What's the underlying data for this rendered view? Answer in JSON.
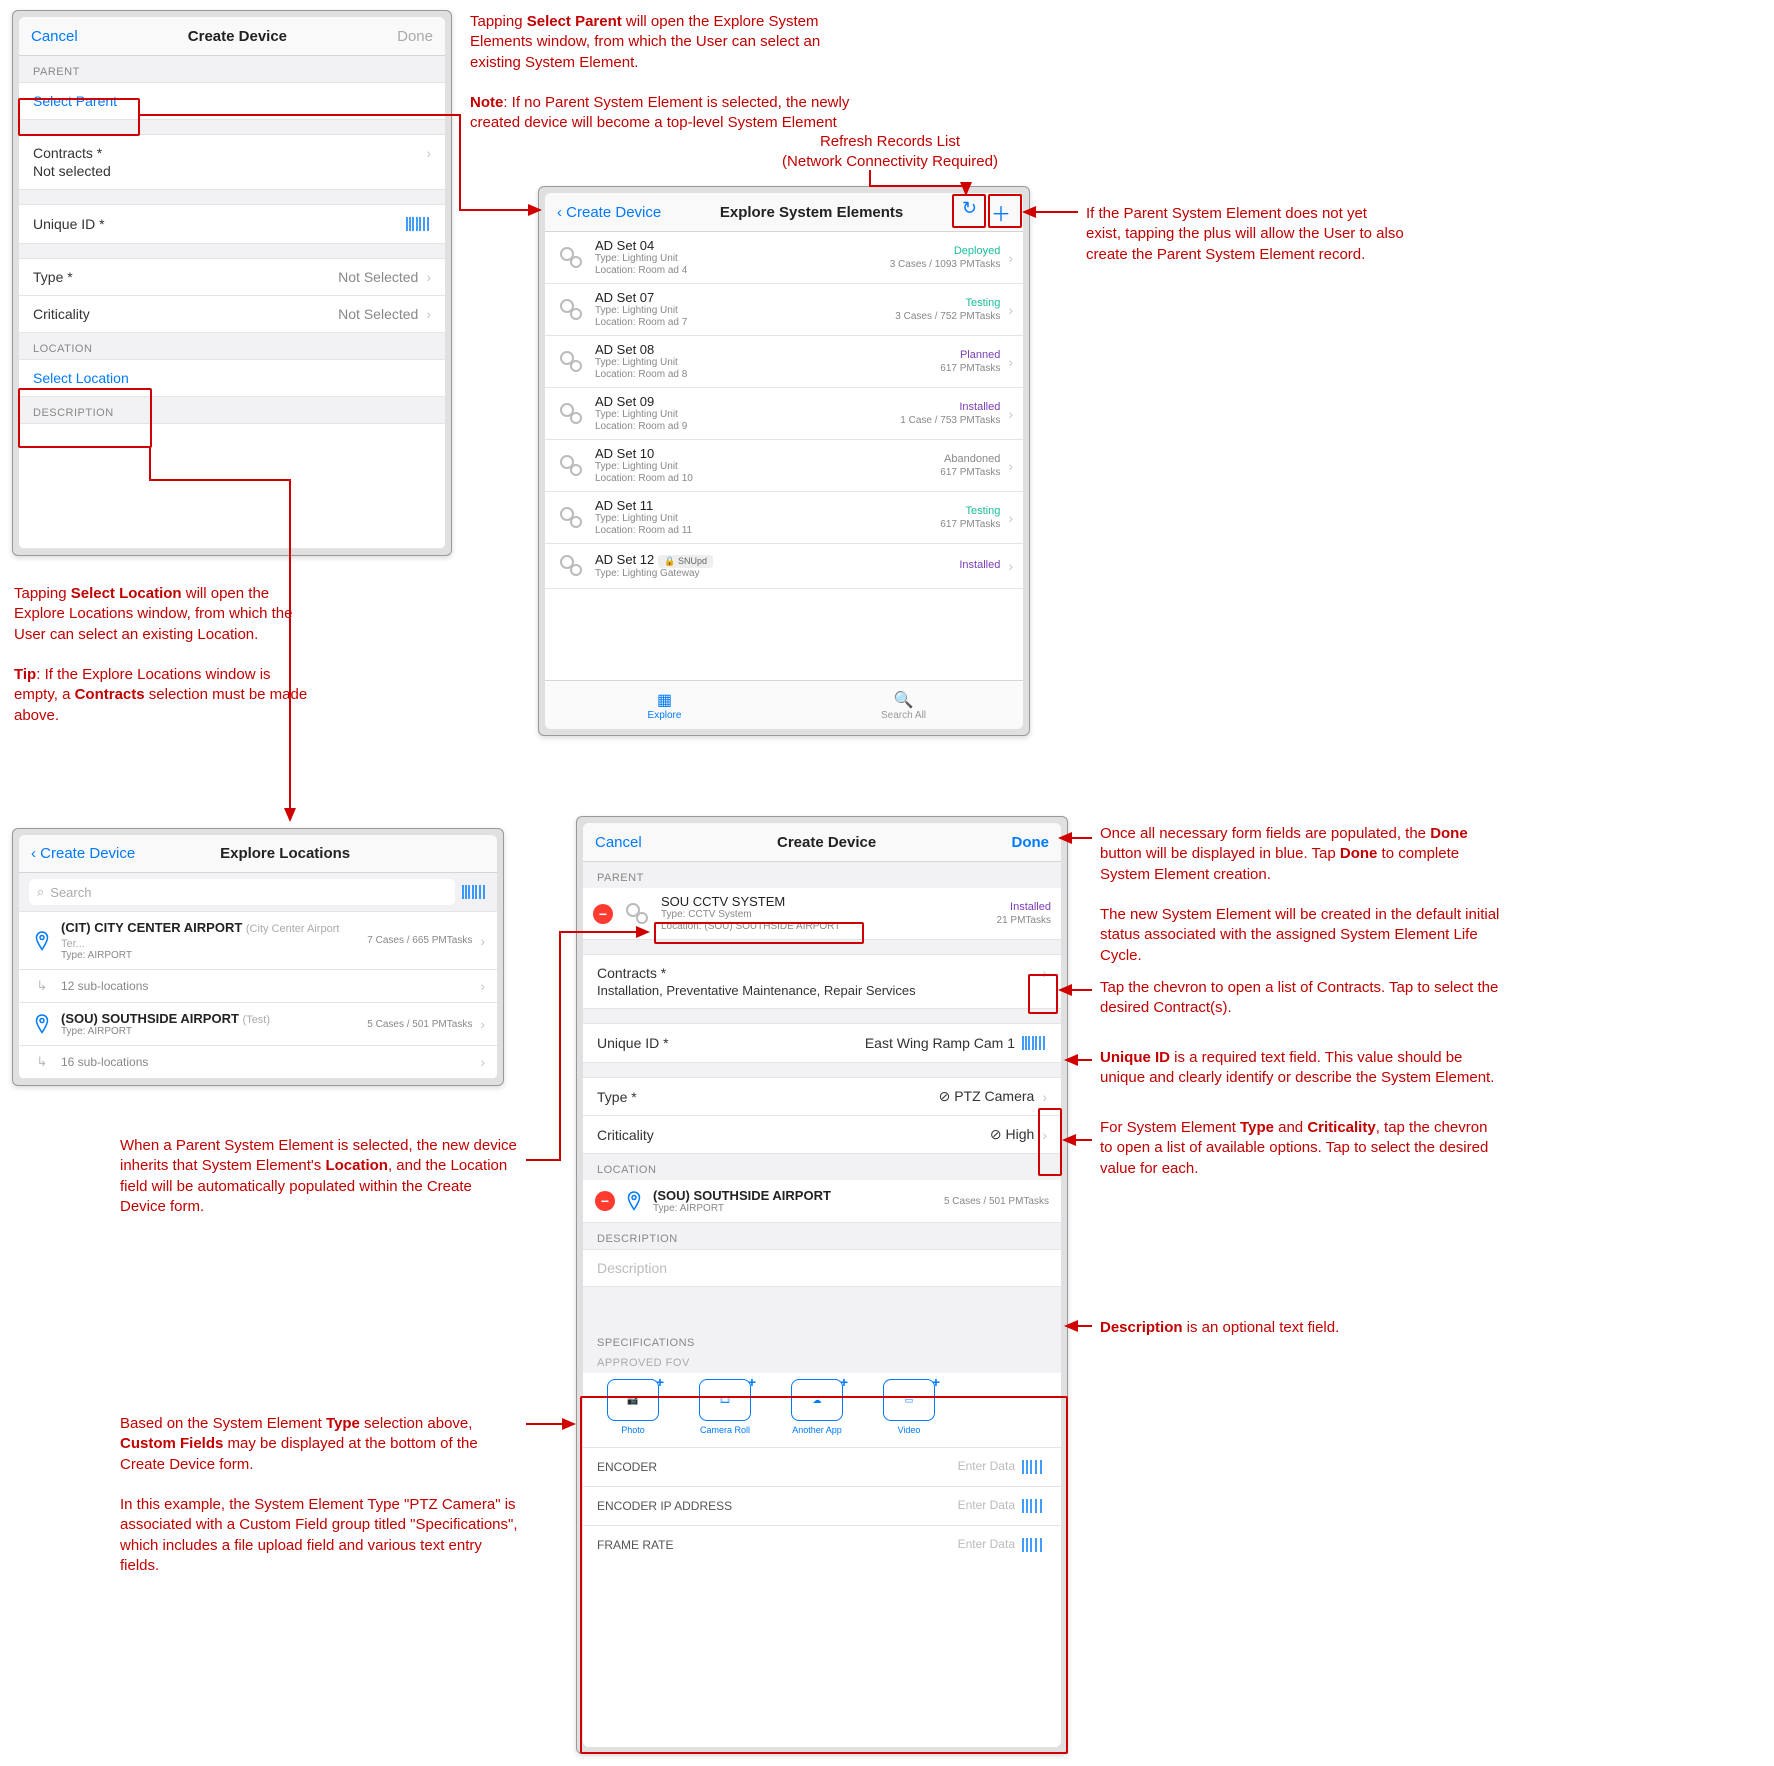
{
  "annotations": {
    "a1": "Tapping <b>Select Parent</b> will open the Explore System Elements window, from which the User can select an existing System Element.",
    "a1note": "<b>Note</b>: If no Parent System Element is selected, the newly created device will become a top-level System Element",
    "a2title": "Refresh Records List",
    "a2sub": "(Network Connectivity Required)",
    "a3": "If the Parent System Element does not yet exist, tapping the plus will allow the User to also create the Parent System Element record.",
    "a4": "Tapping <b>Select Location</b> will open the Explore Locations window, from which the User can select an existing Location.",
    "a4tip": "<b>Tip</b>: If the Explore Locations window is empty, a <b>Contracts</b> selection must be made above.",
    "a5": "When a Parent System Element is selected, the new device inherits that System Element's <b>Location</b>, and the Location field will be automatically populated within the Create Device form.",
    "a6": "Once all necessary form fields are populated, the <b>Done</b> button will be displayed in blue. Tap <b>Done</b> to complete System Element creation.",
    "a6b": "The new System Element will be created in the default initial status associated with the assigned System Element Life Cycle.",
    "a7": "Tap the chevron to open a list of Contracts. Tap to select the desired Contract(s).",
    "a8": "<b>Unique ID</b> is a required text field. This value should be unique and clearly identify or describe the System Element.",
    "a9": "For System Element <b>Type</b> and <b>Criticality</b>, tap the chevron to open a list of available options. Tap to select the desired value for each.",
    "a10": "<b>Description</b> is an optional text field.",
    "a11": "Based on the System Element <b>Type</b> selection above, <b>Custom Fields</b> may be displayed at the bottom of the Create Device form.",
    "a11b": "In this example, the System Element Type \"PTZ Camera\" is associated with a Custom Field group titled \"Specifications\", which includes a file upload field and various text entry fields."
  },
  "panel1": {
    "cancel": "Cancel",
    "title": "Create Device",
    "done": "Done",
    "secParent": "PARENT",
    "selectParent": "Select Parent",
    "contracts": "Contracts *",
    "notSelected": "Not selected",
    "uniqueId": "Unique ID *",
    "type": "Type *",
    "typeVal": "Not Selected",
    "crit": "Criticality",
    "critVal": "Not Selected",
    "secLoc": "LOCATION",
    "selectLoc": "Select Location",
    "secDesc": "DESCRIPTION"
  },
  "panel2": {
    "back": "Create Device",
    "title": "Explore System Elements",
    "rows": [
      {
        "name": "AD Set 04",
        "type": "Lighting Unit",
        "loc": "Room ad 4",
        "status": "Deployed",
        "sc": "st-dep",
        "meta": "3 Cases / 1093 PMTasks"
      },
      {
        "name": "AD Set 07",
        "type": "Lighting Unit",
        "loc": "Room ad 7",
        "status": "Testing",
        "sc": "st-test",
        "meta": "3 Cases / 752 PMTasks"
      },
      {
        "name": "AD Set 08",
        "type": "Lighting Unit",
        "loc": "Room ad 8",
        "status": "Planned",
        "sc": "st-plan",
        "meta": "617 PMTasks"
      },
      {
        "name": "AD Set 09",
        "type": "Lighting Unit",
        "loc": "Room ad 9",
        "status": "Installed",
        "sc": "st-inst",
        "meta": "1 Case / 753 PMTasks"
      },
      {
        "name": "AD Set 10",
        "type": "Lighting Unit",
        "loc": "Room ad 10",
        "status": "Abandoned",
        "sc": "st-aband",
        "meta": "617 PMTasks"
      },
      {
        "name": "AD Set 11",
        "type": "Lighting Unit",
        "loc": "Room ad 11",
        "status": "Testing",
        "sc": "st-test",
        "meta": "617 PMTasks"
      },
      {
        "name": "AD Set 12",
        "type": "Lighting Gateway",
        "loc": "",
        "status": "Installed",
        "sc": "st-inst",
        "meta": "",
        "badge": "SNUpd"
      }
    ],
    "tabExplore": "Explore",
    "tabSearch": "Search All"
  },
  "panel3": {
    "back": "Create Device",
    "title": "Explore Locations",
    "search": "Search",
    "rows": [
      {
        "code": "(CIT) CITY CENTER AIRPORT",
        "hint": "(City Center Airport Ter...",
        "type": "AIRPORT",
        "meta": "7 Cases / 665 PMTasks",
        "sub": "12 sub-locations"
      },
      {
        "code": "(SOU) SOUTHSIDE AIRPORT",
        "hint": "(Test)",
        "type": "AIRPORT",
        "meta": "5 Cases / 501 PMTasks",
        "sub": "16 sub-locations"
      }
    ]
  },
  "panel4": {
    "cancel": "Cancel",
    "title": "Create Device",
    "done": "Done",
    "secParent": "PARENT",
    "parentName": "SOU CCTV SYSTEM",
    "parentType": "CCTV System",
    "parentLoc": "(SOU) SOUTHSIDE AIRPORT",
    "parentStatus": "Installed",
    "parentMeta": "21 PMTasks",
    "contracts": "Contracts *",
    "contractsVal": "Installation, Preventative Maintenance, Repair Services",
    "uniqueId": "Unique ID *",
    "uniqueIdVal": "East Wing Ramp Cam 1",
    "type": "Type *",
    "typeVal": "PTZ Camera",
    "crit": "Criticality",
    "critVal": "High",
    "secLoc": "LOCATION",
    "locName": "(SOU) SOUTHSIDE AIRPORT",
    "locType": "AIRPORT",
    "locMeta": "5 Cases / 501 PMTasks",
    "secDesc": "DESCRIPTION",
    "descPh": "Description",
    "secSpec": "SPECIFICATIONS",
    "fov": "APPROVED FOV",
    "up1": "Photo",
    "up2": "Camera Roll",
    "up3": "Another App",
    "up4": "Video",
    "f1": "ENCODER",
    "f2": "ENCODER IP ADDRESS",
    "f3": "FRAME RATE",
    "ph": "Enter Data",
    "locPrefix": "Location:",
    "typePrefix": "Type:"
  }
}
